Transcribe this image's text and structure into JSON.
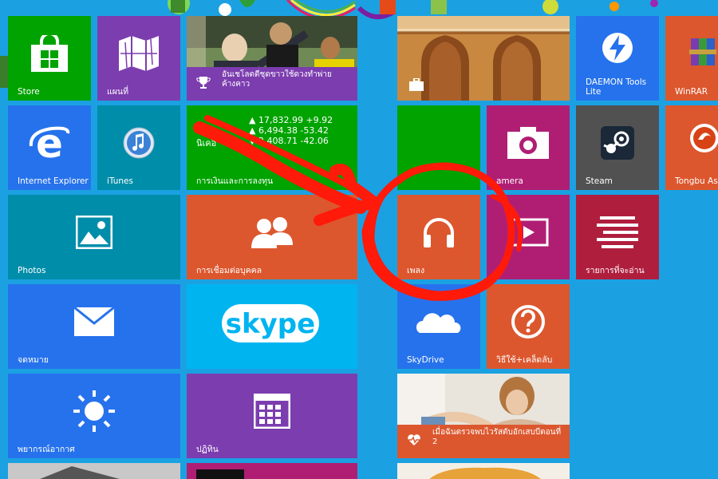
{
  "colors": {
    "background": "#1ba1e2",
    "green": "#00a300",
    "purple": "#7c3daf",
    "orange": "#dc572e",
    "magenta": "#b01e74",
    "teal": "#008da9",
    "dark_gray": "#515151",
    "pen_red": "#ff1a0a"
  },
  "tiles": {
    "store": {
      "label": "Store",
      "icon": "shopping-bag-icon"
    },
    "maps": {
      "label": "แผนที่",
      "icon": "map-icon"
    },
    "sports": {
      "caption": "อันเชโลตตีชุดขาวใช้ดวงทำพ่ายค้างคาว",
      "icon": "trophy-icon"
    },
    "ie": {
      "label": "Internet Explorer",
      "icon": "ie-icon"
    },
    "itunes": {
      "label": "iTunes",
      "icon": "itunes-icon"
    },
    "finance": {
      "label": "การเงินและการลงทุน",
      "rows": [
        "▲ 17,832.99 +9.92",
        "▲ 6,494.38 -53.42",
        "▼ 2,408.71 -42.06"
      ],
      "index_label": "นิเคอิ"
    },
    "photos": {
      "label": "Photos",
      "icon": "photo-icon"
    },
    "people": {
      "label": "การเชื่อมต่อบุคคล",
      "icon": "people-icon"
    },
    "mail": {
      "label": "จดหมาย",
      "icon": "mail-icon"
    },
    "skype": {
      "logo": "skype"
    },
    "weather": {
      "label": "พยากรณ์อากาศ",
      "icon": "sun-icon"
    },
    "calendar": {
      "label": "ปฏิทิน",
      "icon": "calendar-icon"
    },
    "travel": {
      "icon": "suitcase-icon"
    },
    "daemon": {
      "label": "DAEMON Tools Lite",
      "icon": "lightning-icon"
    },
    "winrar": {
      "label": "WinRAR",
      "icon": "books-icon"
    },
    "camera": {
      "label": "amera",
      "icon": "camera-icon"
    },
    "steam": {
      "label": "Steam",
      "icon": "steam-icon"
    },
    "tongbu": {
      "label": "Tongbu Ass",
      "icon": "tongbu-icon"
    },
    "music": {
      "label": "เพลง",
      "icon": "headphones-icon"
    },
    "video": {
      "label": "",
      "icon": "video-icon"
    },
    "reading": {
      "label": "รายการที่จะอ่าน",
      "icon": "reading-list-icon"
    },
    "skydrive": {
      "label": "SkyDrive",
      "icon": "cloud-icon"
    },
    "help": {
      "label": "วิธีใช้+เคล็ดลับ",
      "icon": "question-icon"
    },
    "health": {
      "caption": "เมื่อฉันตรวจพบไวรัสตับอักเสบบีตอนที่ 2",
      "icon": "heart-pulse-icon"
    }
  }
}
